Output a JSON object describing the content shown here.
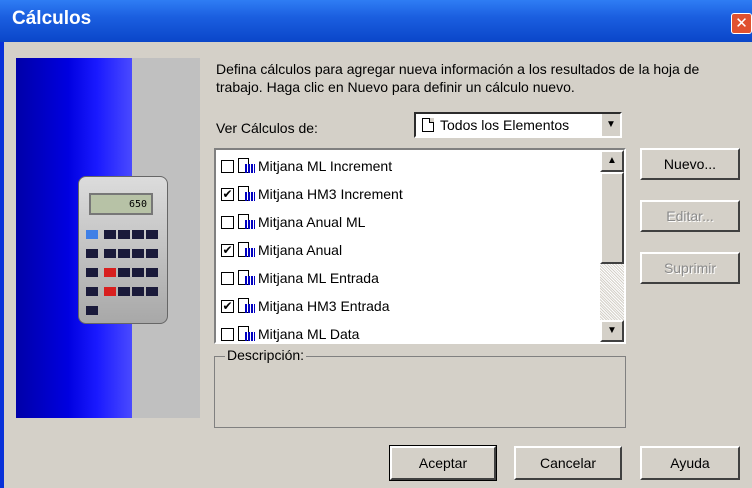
{
  "window": {
    "title": "Cálculos"
  },
  "illustration": {
    "calculator_display": "650"
  },
  "description_text": "Defina cálculos para agregar nueva información a los resultados de la hoja de trabajo. Haga clic en Nuevo para definir un cálculo nuevo.",
  "filter": {
    "label": "Ver Cálculos de:",
    "selected": "Todos los Elementos"
  },
  "calculations": [
    {
      "label": "Mitjana ML Increment",
      "checked": false
    },
    {
      "label": "Mitjana HM3 Increment",
      "checked": true
    },
    {
      "label": "Mitjana Anual ML",
      "checked": false
    },
    {
      "label": "Mitjana Anual",
      "checked": true
    },
    {
      "label": "Mitjana ML Entrada",
      "checked": false
    },
    {
      "label": "Mitjana HM3 Entrada",
      "checked": true
    },
    {
      "label": "Mitjana ML Data",
      "checked": false
    }
  ],
  "description_box": {
    "label": "Descripción:"
  },
  "side_buttons": {
    "new": "Nuevo...",
    "edit": "Editar...",
    "delete": "Suprimir"
  },
  "footer_buttons": {
    "ok": "Aceptar",
    "cancel": "Cancelar",
    "help": "Ayuda"
  },
  "colors": {
    "titlebar": "#0a46c9",
    "panel_blue": "#0000e0",
    "dialog": "#d4d0c8"
  }
}
